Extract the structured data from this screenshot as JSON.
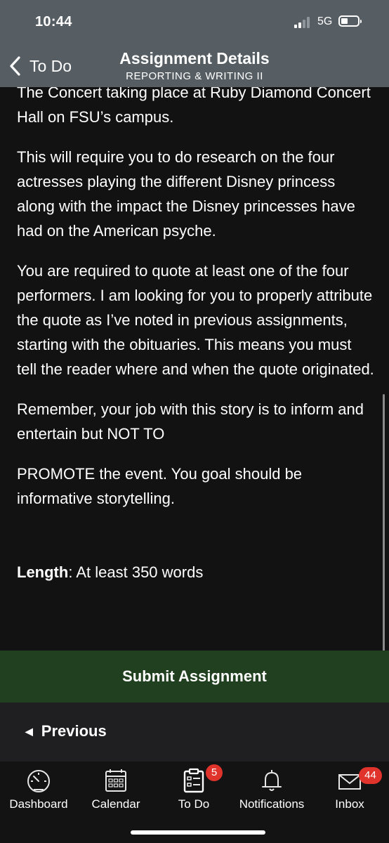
{
  "status_bar": {
    "time": "10:44",
    "network": "5G"
  },
  "header": {
    "back_label": "To Do",
    "title": "Assignment Details",
    "subtitle": "REPORTING & WRITING II"
  },
  "content": {
    "paragraphs": [
      "The Concert taking place at Ruby Diamond Concert Hall on FSU’s campus.",
      "This will require you to do research on the four actresses playing the different Disney princess along with the impact the Disney princesses have had on the American psyche.",
      "You are required to quote at least one of the four performers. I am looking for you to properly attribute the quote as I’ve noted in previous assignments, starting with the obituaries. This means you must tell the reader where and when the quote originated.",
      "Remember, your job with this story is to inform and entertain but NOT TO",
      "PROMOTE the event. You goal should be informative storytelling."
    ],
    "length_label": "Length",
    "length_separator": ":",
    "length_value": " At least 350 words"
  },
  "actions": {
    "submit_label": "Submit Assignment",
    "previous_label": "Previous"
  },
  "tab_bar": {
    "items": [
      {
        "label": "Dashboard",
        "icon": "speedometer-icon"
      },
      {
        "label": "Calendar",
        "icon": "calendar-icon"
      },
      {
        "label": "To Do",
        "icon": "clipboard-icon",
        "badge": "5"
      },
      {
        "label": "Notifications",
        "icon": "bell-icon"
      },
      {
        "label": "Inbox",
        "icon": "envelope-icon",
        "badge": "44"
      }
    ]
  },
  "colors": {
    "header_bg": "#565e64",
    "content_bg": "#121212",
    "submit_bg": "#21401f",
    "badge_bg": "#e0332b"
  }
}
